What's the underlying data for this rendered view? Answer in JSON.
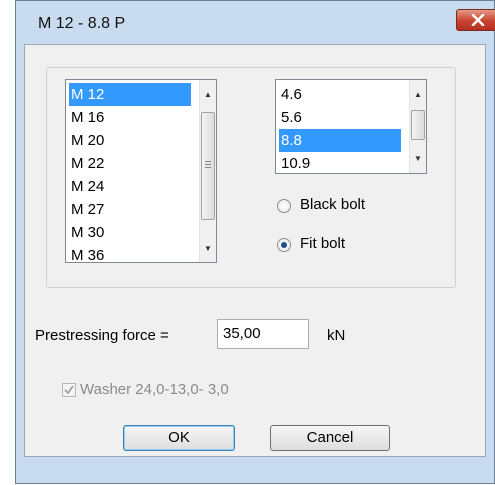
{
  "window": {
    "title": "M 12 - 8.8 P"
  },
  "sizes": {
    "items": [
      "M 12",
      "M 16",
      "M 20",
      "M 22",
      "M 24",
      "M 27",
      "M 30",
      "M 36"
    ],
    "selected": "M 12"
  },
  "grades": {
    "items": [
      "4.6",
      "5.6",
      "8.8",
      "10.9"
    ],
    "selected": "8.8"
  },
  "bolt_type": {
    "black_label": "Black bolt",
    "fit_label": "Fit bolt",
    "selected": "Fit bolt"
  },
  "prestress": {
    "label": "Prestressing  force =",
    "value": "35,00",
    "unit": "kN"
  },
  "washer": {
    "label": "Washer 24,0-13,0- 3,0",
    "checked": true
  },
  "buttons": {
    "ok": "OK",
    "cancel": "Cancel"
  }
}
